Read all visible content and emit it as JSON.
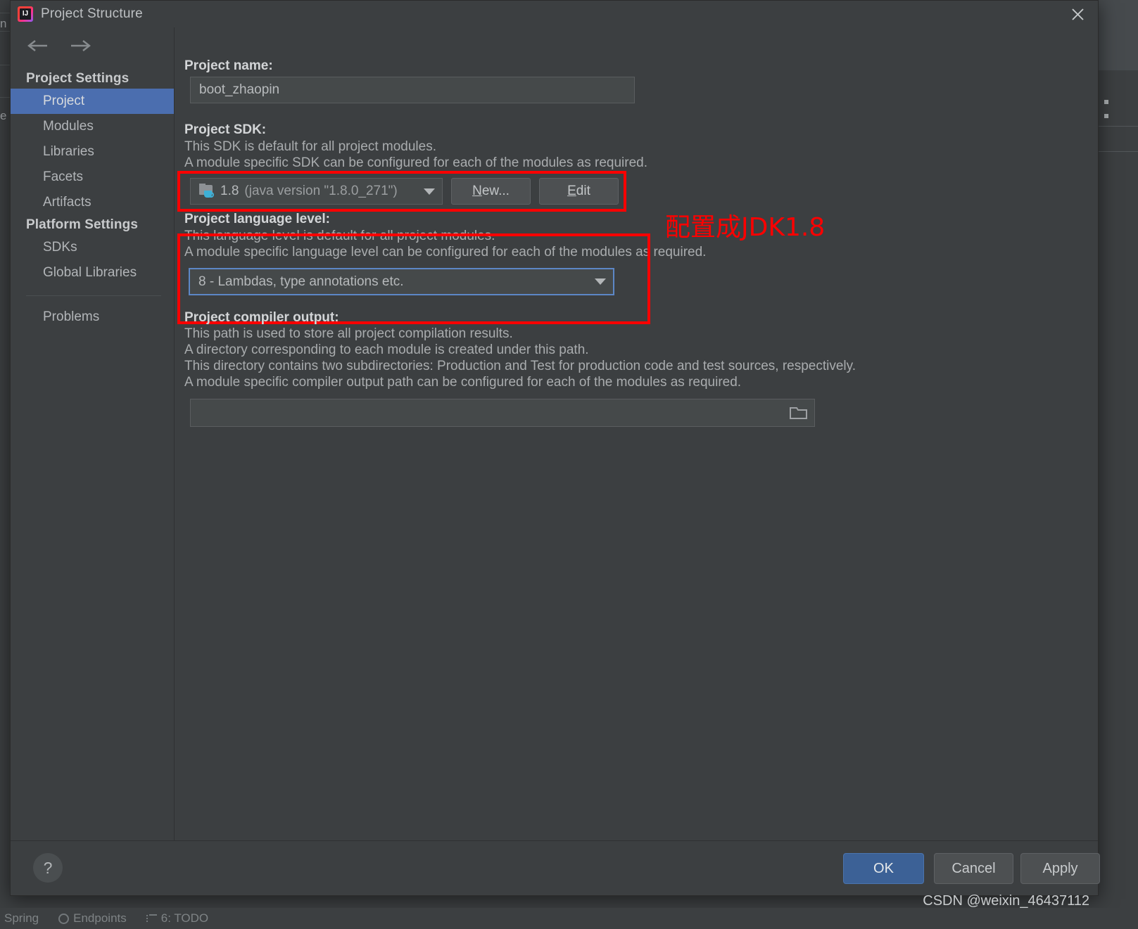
{
  "window": {
    "title": "Project Structure",
    "app_icon": "intellij-idea-icon",
    "close_icon": "close-icon"
  },
  "sidebar": {
    "back_icon": "arrow-left-icon",
    "forward_icon": "arrow-right-icon",
    "groups": [
      {
        "heading": "Project Settings",
        "items": [
          {
            "label": "Project",
            "selected": true
          },
          {
            "label": "Modules",
            "selected": false
          },
          {
            "label": "Libraries",
            "selected": false
          },
          {
            "label": "Facets",
            "selected": false
          },
          {
            "label": "Artifacts",
            "selected": false
          }
        ]
      },
      {
        "heading": "Platform Settings",
        "items": [
          {
            "label": "SDKs",
            "selected": false
          },
          {
            "label": "Global Libraries",
            "selected": false
          }
        ]
      }
    ],
    "extra_items": [
      {
        "label": "Problems",
        "selected": false
      }
    ]
  },
  "main": {
    "project_name": {
      "label": "Project name:",
      "value": "boot_zhaopin",
      "placeholder": ""
    },
    "project_sdk": {
      "label": "Project SDK:",
      "desc_line1": "This SDK is default for all project modules.",
      "desc_line2": "A module specific SDK can be configured for each of the modules as required.",
      "selected_version": "1.8",
      "selected_detail": "(java version \"1.8.0_271\")",
      "sdk_icon": "java-sdk-icon",
      "new_button": "New...",
      "edit_button": "Edit"
    },
    "language_level": {
      "label": "Project language level:",
      "desc_line1": "This language level is default for all project modules.",
      "desc_line2": "A module specific language level can be configured for each of the modules as required.",
      "selected": "8 - Lambdas, type annotations etc."
    },
    "compiler_output": {
      "label": "Project compiler output:",
      "desc_line1": "This path is used to store all project compilation results.",
      "desc_line2": "A directory corresponding to each module is created under this path.",
      "desc_line3": "This directory contains two subdirectories: Production and Test for production code and test sources, respectively.",
      "desc_line4": "A module specific compiler output path can be configured for each of the modules as required.",
      "value": "",
      "placeholder": "",
      "browse_icon": "folder-browse-icon"
    }
  },
  "annotations": {
    "jdk_note": "配置成JDK1.8",
    "highlight_color": "#ff0000"
  },
  "footer": {
    "help_icon": "help-question-icon",
    "ok_label": "OK",
    "cancel_label": "Cancel",
    "apply_label": "Apply",
    "watermark": "CSDN @weixin_46437112"
  },
  "ide_statusbar": {
    "items": [
      {
        "label": "Spring",
        "icon": "spring-icon"
      },
      {
        "label": "Endpoints",
        "icon": "endpoints-icon"
      },
      {
        "label": "6: TODO",
        "icon": "todo-list-icon"
      }
    ]
  },
  "background": {
    "left_fragments": [
      "n",
      "e"
    ]
  },
  "colors": {
    "dialog_bg": "#3c3f41",
    "sidebar_selected": "#4b6eaf",
    "ok_button": "#3c6196",
    "input_bg": "#45494a",
    "annotation_red": "#ff0000",
    "focus_border": "#5c87c6"
  }
}
